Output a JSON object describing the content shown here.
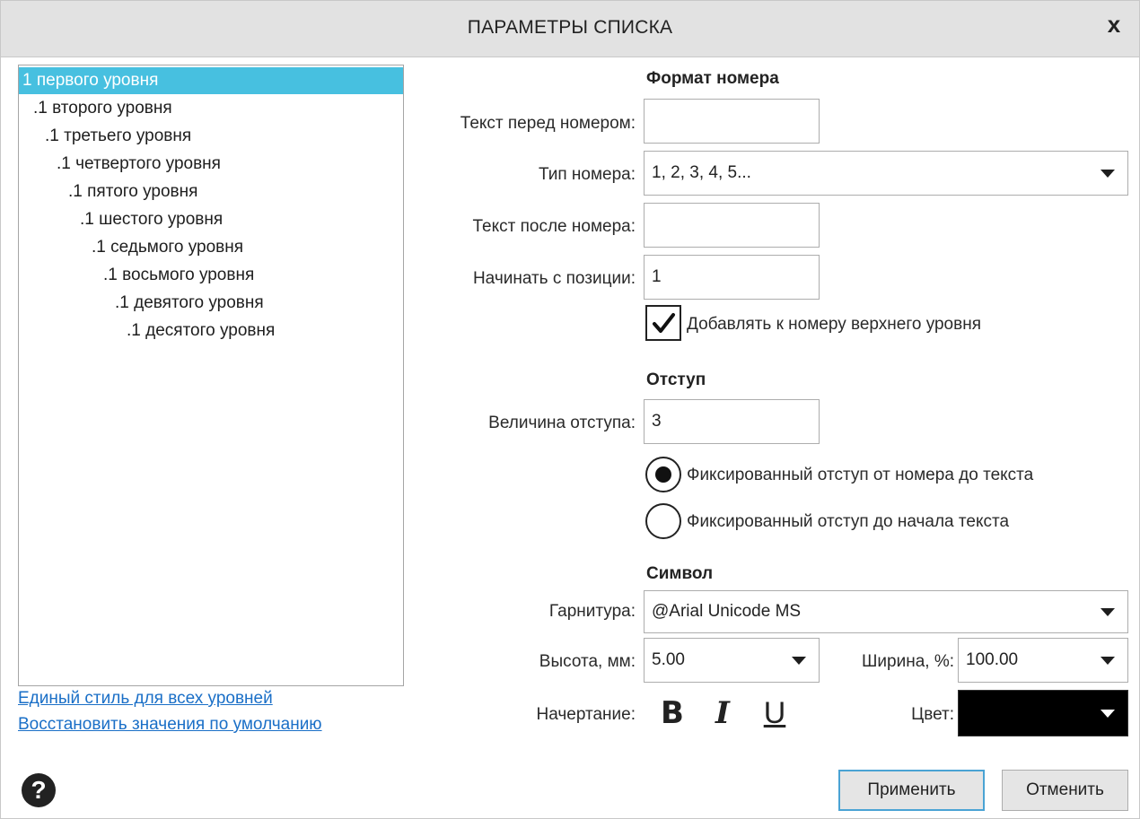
{
  "dialog": {
    "title": "ПАРАМЕТРЫ СПИСКА",
    "close_label": "x"
  },
  "levels": [
    {
      "text": "1 первого уровня",
      "selected": true
    },
    {
      "text": ".1 второго уровня"
    },
    {
      "text": ".1 третьего уровня"
    },
    {
      "text": ".1 четвертого уровня"
    },
    {
      "text": ".1 пятого уровня"
    },
    {
      "text": ".1 шестого уровня"
    },
    {
      "text": ".1 седьмого уровня"
    },
    {
      "text": ".1 восьмого уровня"
    },
    {
      "text": ".1 девятого уровня"
    },
    {
      "text": ".1 десятого уровня"
    }
  ],
  "links": {
    "unified_style": "Единый стиль для всех уровней",
    "restore_defaults": "Восстановить значения по умолчанию"
  },
  "number_format": {
    "heading": "Формат номера",
    "text_before_label": "Текст перед номером:",
    "text_before_value": "",
    "type_label": "Тип номера:",
    "type_value": "1, 2, 3, 4, 5...",
    "text_after_label": "Текст после номера:",
    "text_after_value": "",
    "start_label": "Начинать с позиции:",
    "start_value": "1",
    "add_upper_label": "Добавлять к номеру верхнего уровня",
    "add_upper_checked": true
  },
  "indent": {
    "heading": "Отступ",
    "size_label": "Величина отступа:",
    "size_value": "3",
    "fixed_from_number_label": "Фиксированный отступ от номера до текста",
    "fixed_to_text_label": "Фиксированный отступ до начала текста",
    "selected_option": "fixed_from_number"
  },
  "symbol": {
    "heading": "Символ",
    "font_label": "Гарнитура:",
    "font_value": "@Arial Unicode MS",
    "height_label": "Высота, мм:",
    "height_value": "5.00",
    "width_label": "Ширина, %:",
    "width_value": "100.00",
    "style_label": "Начертание:",
    "bold_glyph": "B",
    "italic_glyph": "I",
    "underline_glyph": "U",
    "color_label": "Цвет:",
    "color_value": "#000000"
  },
  "buttons": {
    "apply": "Применить",
    "cancel": "Отменить",
    "help_glyph": "?"
  },
  "colors": {
    "accent": "#47c0e0",
    "link": "#1a6fc7",
    "titlebar": "#e2e2e2",
    "primary_border": "#4aa3d4"
  },
  "icons": [
    "close-icon",
    "checkmark-icon",
    "radio-selected-icon",
    "radio-empty-icon",
    "dropdown-caret-icon",
    "help-icon"
  ]
}
